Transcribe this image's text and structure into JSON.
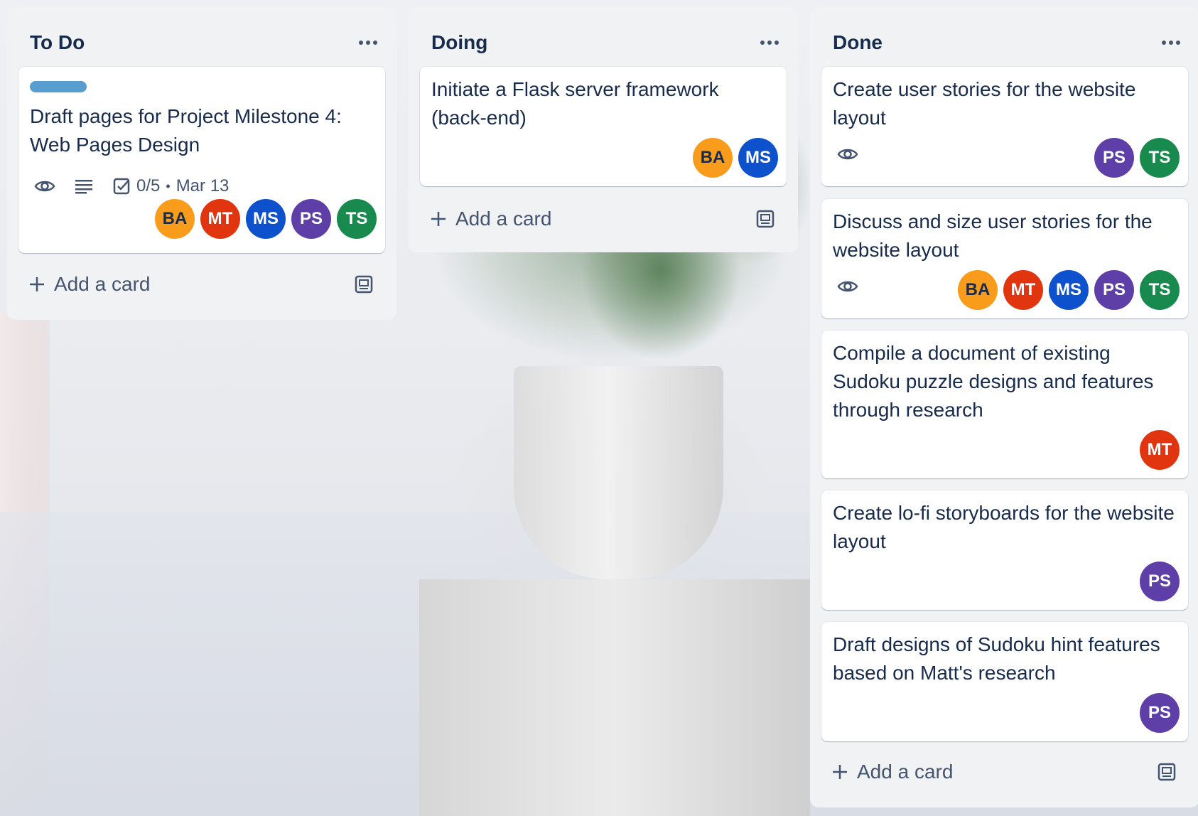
{
  "lists": [
    {
      "title": "To Do",
      "add_label": "Add a card",
      "cards": [
        {
          "title": "Draft pages for Project Milestone 4: Web Pages Design",
          "label_color": "#579dcf",
          "badges": {
            "watch": "eye-icon",
            "description": "description-icon",
            "checklist": "0/5",
            "due": "Mar 13",
            "separator": "•"
          },
          "members": [
            "BA",
            "MT",
            "MS",
            "PS",
            "TS"
          ]
        }
      ]
    },
    {
      "title": "Doing",
      "add_label": "Add a card",
      "cards": [
        {
          "title": "Initiate a Flask server framework (back-end)",
          "members": [
            "BA",
            "MS"
          ]
        }
      ]
    },
    {
      "title": "Done",
      "add_label": "Add a card",
      "cards": [
        {
          "title": "Create user stories for the website layout",
          "watching": true,
          "members": [
            "PS",
            "TS"
          ]
        },
        {
          "title": "Discuss and size user stories for the website layout",
          "watching": true,
          "members": [
            "BA",
            "MT",
            "MS",
            "PS",
            "TS"
          ]
        },
        {
          "title": "Compile a document of existing Sudoku puzzle designs and features through research",
          "members": [
            "MT"
          ]
        },
        {
          "title": "Create lo-fi storyboards for the website layout",
          "members": [
            "PS"
          ]
        },
        {
          "title": "Draft designs of Sudoku hint features based on Matt's research",
          "members": [
            "PS"
          ]
        }
      ]
    }
  ],
  "member_colors": {
    "BA": "#f99c1b",
    "MT": "#e0350f",
    "MS": "#0d52cc",
    "PS": "#5e3fa8",
    "TS": "#198a4e"
  }
}
